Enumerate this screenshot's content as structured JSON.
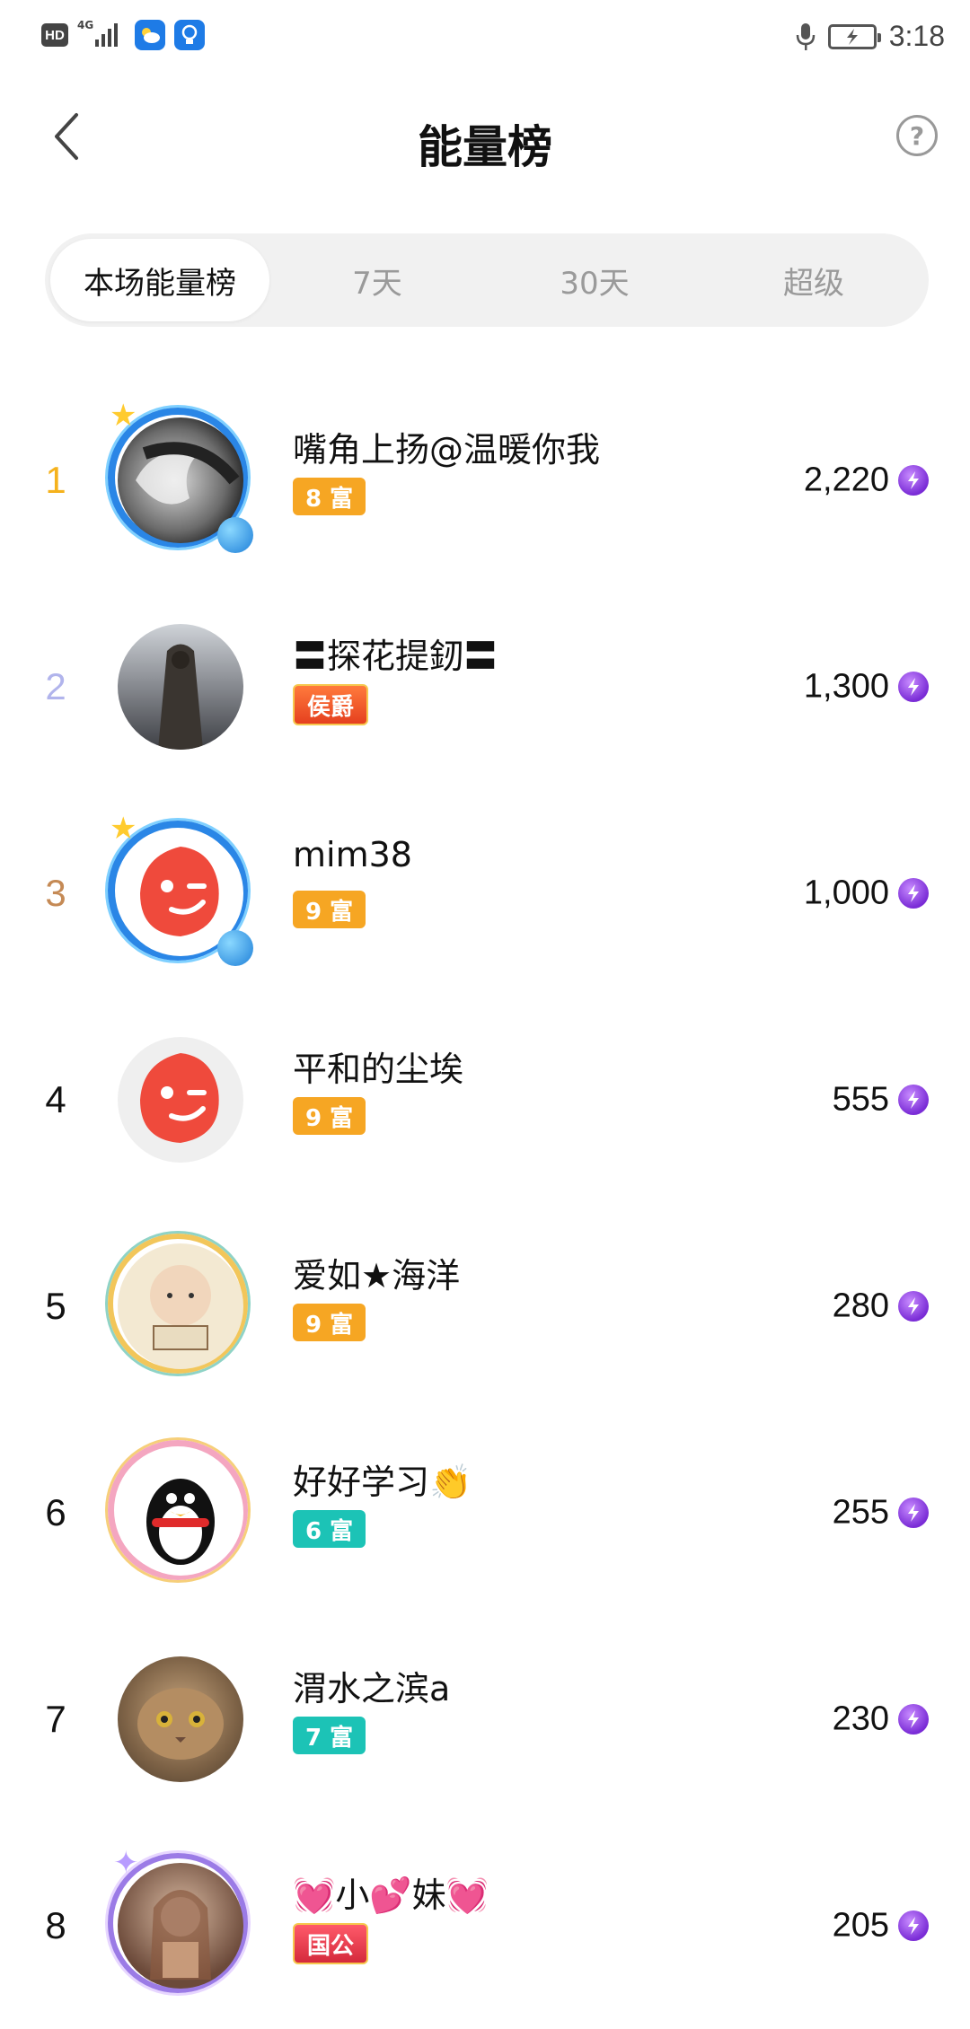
{
  "status_bar": {
    "time": "3:18",
    "hd": "HD",
    "network": "4G"
  },
  "header": {
    "title": "能量榜",
    "help": "?"
  },
  "tabs": [
    {
      "label": "本场能量榜",
      "active": true
    },
    {
      "label": "7天",
      "active": false
    },
    {
      "label": "30天",
      "active": false
    },
    {
      "label": "超级",
      "active": false
    }
  ],
  "colors": {
    "rank1": "#f5b21c",
    "rank2": "#b1b4ec",
    "rank3": "#c58a55",
    "rank_other": "#111111",
    "badge_orange": "#f6a623",
    "badge_teal": "#1cc3b6",
    "badge_red": "#f0552d",
    "energy_purple": "#8a3be0"
  },
  "rows": [
    {
      "rank": "1",
      "name": "嘴角上扬@温暖你我",
      "badge": "8 富",
      "score": "2,220"
    },
    {
      "rank": "2",
      "name": "〓探花提釰〓",
      "badge": "侯爵",
      "score": "1,300"
    },
    {
      "rank": "3",
      "name": "mim38",
      "badge": "9 富",
      "score": "1,000"
    },
    {
      "rank": "4",
      "name": "平和的尘埃",
      "badge": "9 富",
      "score": "555"
    },
    {
      "rank": "5",
      "name": "爱如★海洋",
      "badge": "9 富",
      "score": "280"
    },
    {
      "rank": "6",
      "name": "好好学习👏",
      "badge": "6 富",
      "score": "255"
    },
    {
      "rank": "7",
      "name": "渭水之滨a",
      "badge": "7 富",
      "score": "230"
    },
    {
      "rank": "8",
      "name": "💓小💕妹💓",
      "badge": "国公",
      "score": "205"
    }
  ]
}
